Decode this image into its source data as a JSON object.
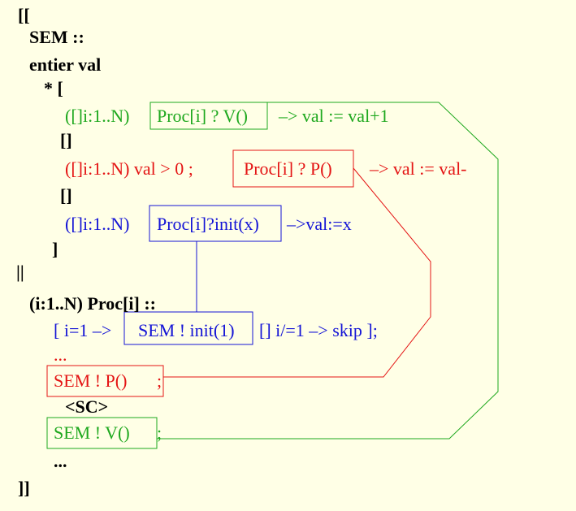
{
  "colors": {
    "background": "#ffffe6",
    "black": "#000000",
    "green": "#1ea81e",
    "red": "#e41414",
    "blue": "#1414d6"
  },
  "lines": {
    "open": "[[",
    "sem_decl": "SEM ::",
    "entier": "entier val",
    "star": "* [",
    "guard_v_prefix": "([]i:1..N)",
    "guard_v_recv": "Proc[i] ? V()",
    "guard_v_action": "–> val := val+1",
    "sep1": "[]",
    "guard_p_prefix": "([]i:1..N) val > 0 ;",
    "guard_p_recv": "Proc[i] ? P()",
    "guard_p_action": "–> val := val-",
    "sep2": "[]",
    "guard_init_prefix": "([]i:1..N)",
    "guard_init_recv": "Proc[i]?init(x)",
    "guard_init_action": "–>val:=x",
    "close_inner": "]",
    "parallel": "||",
    "proc_decl": "(i:1..N) Proc[i] ::",
    "init_prefix": "[ i=1 –>",
    "init_send": "SEM ! init(1)",
    "init_suffix": "[] i/=1 –> skip ];",
    "ellipsis_red": "...",
    "send_p": "SEM ! P()",
    "send_p_semi": ";",
    "sc": "<SC>",
    "send_v": "SEM ! V()",
    "send_v_semi": ";",
    "ellipsis_black": "...",
    "close": "]]"
  }
}
